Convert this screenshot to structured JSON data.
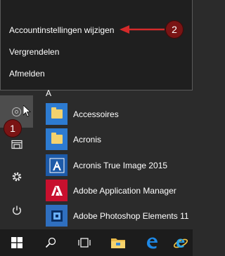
{
  "flyout": {
    "items": [
      {
        "label": "Accountinstellingen wijzigen"
      },
      {
        "label": "Vergrendelen"
      },
      {
        "label": "Afmelden"
      }
    ]
  },
  "callouts": {
    "one": "1",
    "two": "2"
  },
  "start": {
    "section_letter": "A",
    "apps": [
      {
        "label": "Accessoires",
        "icon": "folder-icon"
      },
      {
        "label": "Acronis",
        "icon": "folder-icon"
      },
      {
        "label": "Acronis True Image 2015",
        "icon": "acronis-true-image-icon"
      },
      {
        "label": "Adobe Application Manager",
        "icon": "adobe-icon"
      },
      {
        "label": "Adobe Photoshop Elements 11",
        "icon": "photoshop-elements-icon"
      }
    ]
  },
  "rail": {
    "icons": [
      "user-icon",
      "file-explorer-icon",
      "settings-icon",
      "power-icon"
    ]
  },
  "taskbar": {
    "icons": [
      "windows-start-icon",
      "search-icon",
      "task-view-icon",
      "file-explorer-icon",
      "edge-icon",
      "internet-explorer-icon"
    ]
  },
  "colors": {
    "accent": "#2d7bd1",
    "callout": "#7a1414",
    "arrow": "#d42a2a"
  }
}
